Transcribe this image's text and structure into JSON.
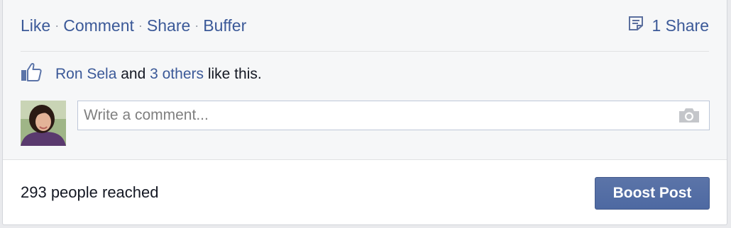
{
  "post_actions": {
    "like": "Like",
    "comment": "Comment",
    "share": "Share",
    "buffer": "Buffer",
    "separator": "·"
  },
  "share_count": {
    "icon": "share-page-icon",
    "label": "1 Share"
  },
  "likes": {
    "icon": "thumbs-up-icon",
    "person": "Ron Sela",
    "and_text": " and ",
    "others": "3 others",
    "suffix": " like this."
  },
  "comment": {
    "placeholder": "Write a comment...",
    "camera_icon": "camera-icon"
  },
  "footer": {
    "reach": "293 people reached",
    "boost_label": "Boost Post"
  },
  "colors": {
    "link": "#3b5998",
    "button": "#4e69a2",
    "feedback_bg": "#f6f7f8"
  }
}
